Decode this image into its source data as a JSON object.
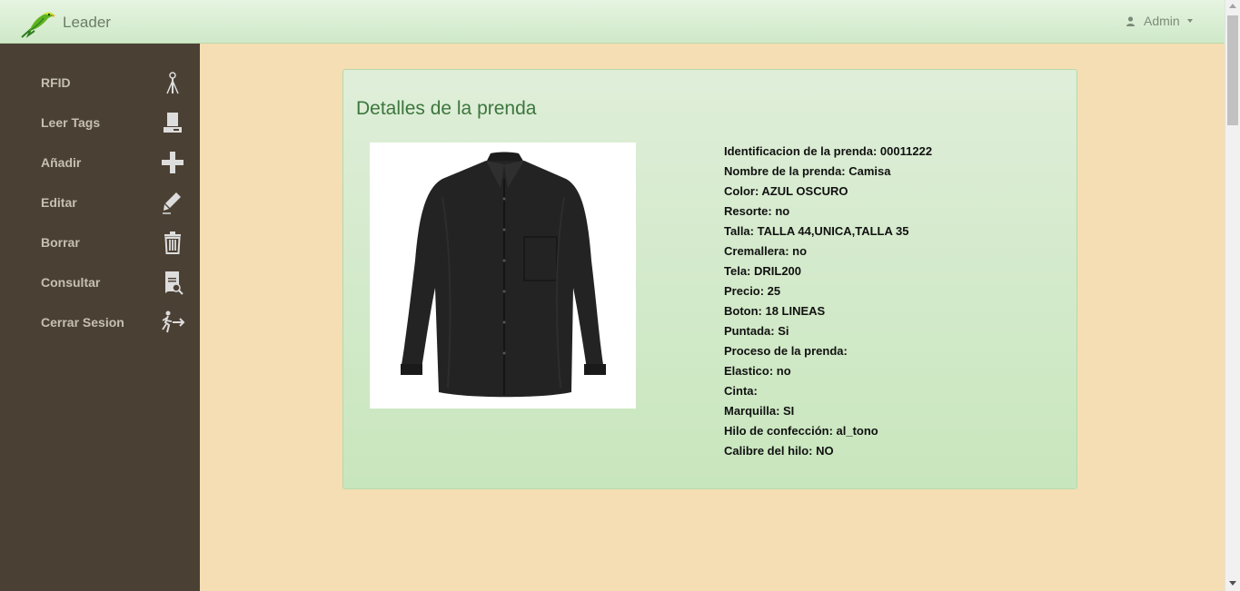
{
  "navbar": {
    "brand": "Leader",
    "user": "Admin",
    "logo_icon": "parrot-logo",
    "colors": {
      "bar": "#d6ecd0",
      "text": "#6a7e65"
    }
  },
  "sidebar": {
    "background": "#4b4034",
    "items": [
      {
        "label": "RFID",
        "icon": "antenna-icon"
      },
      {
        "label": "Leer Tags",
        "icon": "reader-icon"
      },
      {
        "label": "Añadir",
        "icon": "plus-icon"
      },
      {
        "label": "Editar",
        "icon": "pencil-icon"
      },
      {
        "label": "Borrar",
        "icon": "trash-icon"
      },
      {
        "label": "Consultar",
        "icon": "search-document-icon"
      },
      {
        "label": "Cerrar Sesion",
        "icon": "logout-icon"
      }
    ]
  },
  "panel": {
    "title": "Detalles de la prenda",
    "image": "black-shirt",
    "details": [
      "Identificacion de la prenda: 00011222",
      "Nombre de la prenda: Camisa",
      "Color: AZUL OSCURO",
      "Resorte: no",
      "Talla: TALLA 44,UNICA,TALLA 35",
      "Cremallera: no",
      "Tela: DRIL200",
      "Precio: 25",
      "Boton: 18 LINEAS",
      "Puntada: Si",
      "Proceso de la prenda:",
      "Elastico: no",
      "Cinta:",
      "Marquilla: SI",
      "Hilo de confección: al_tono",
      "Calibre del hilo: NO"
    ]
  },
  "colors": {
    "page_bg": "#f5deb3",
    "title": "#3c763d"
  }
}
